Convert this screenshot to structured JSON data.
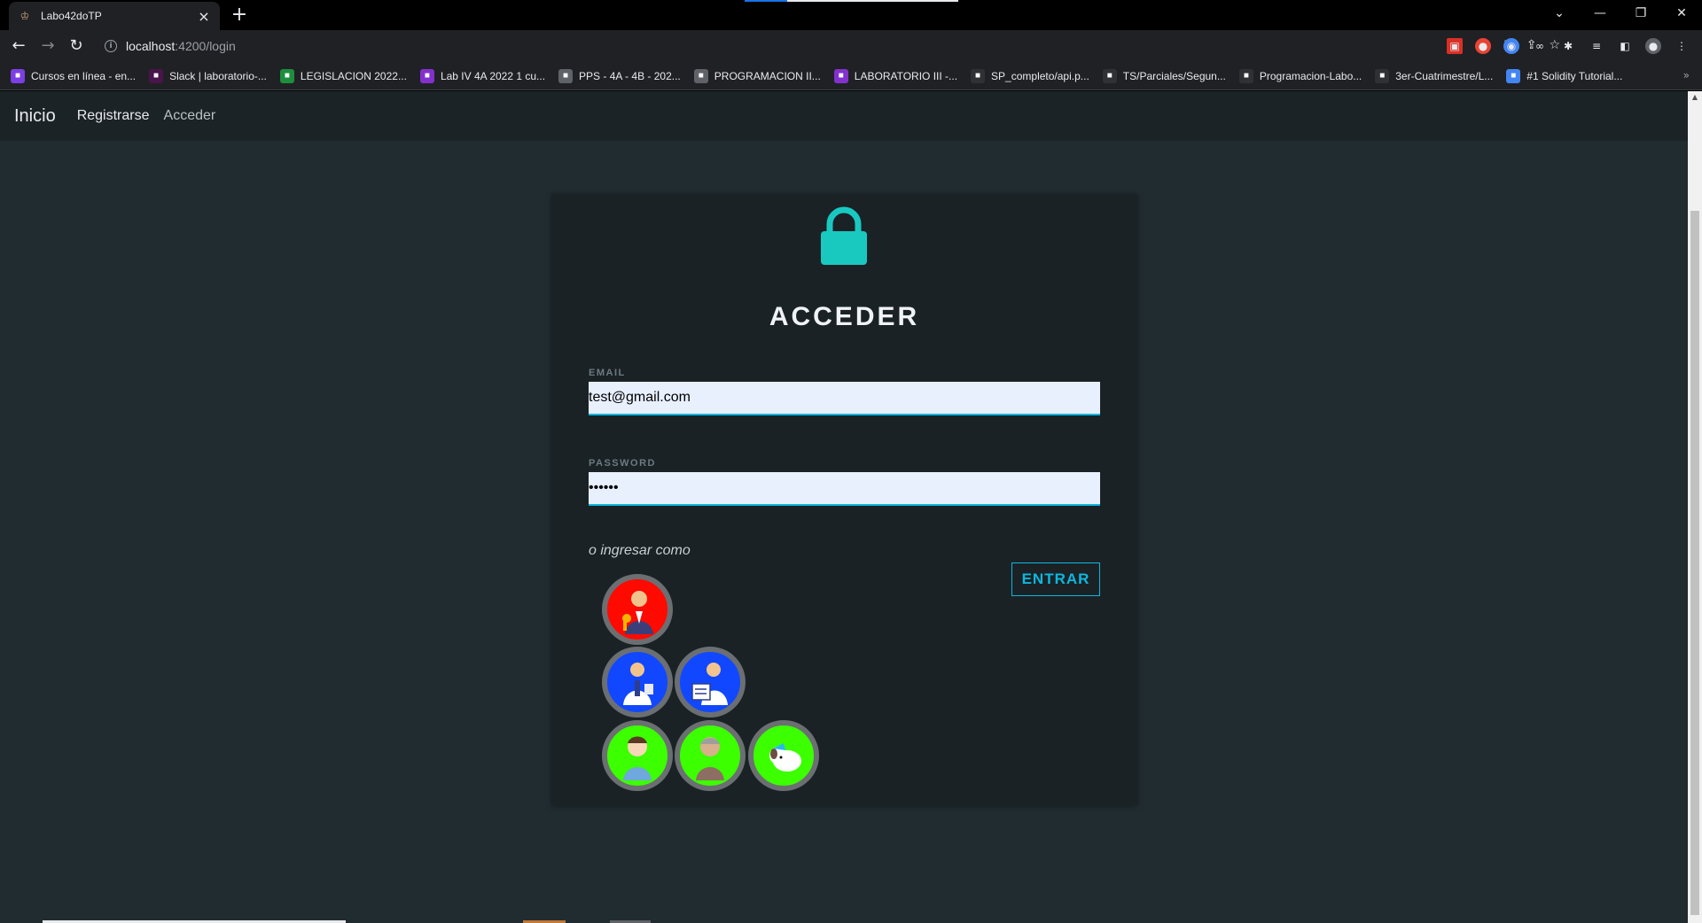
{
  "browser": {
    "tab_title": "Labo42doTP",
    "url_host": "localhost",
    "url_path": ":4200/login",
    "bookmarks": [
      {
        "label": "Cursos en línea - en...",
        "color": "#7b3fe4"
      },
      {
        "label": "Slack | laboratorio-...",
        "color": "#4a154b"
      },
      {
        "label": "LEGISLACION 2022...",
        "color": "#1e8e3e"
      },
      {
        "label": "Lab IV 4A 2022 1 cu...",
        "color": "#8430ce"
      },
      {
        "label": "PPS - 4A - 4B - 202...",
        "color": "#5f6368"
      },
      {
        "label": "PROGRAMACION II...",
        "color": "#5f6368"
      },
      {
        "label": "LABORATORIO III -...",
        "color": "#8430ce"
      },
      {
        "label": "SP_completo/api.p...",
        "color": "#303134"
      },
      {
        "label": "TS/Parciales/Segun...",
        "color": "#303134"
      },
      {
        "label": "Programacion-Labo...",
        "color": "#303134"
      },
      {
        "label": "3er-Cuatrimestre/L...",
        "color": "#303134"
      },
      {
        "label": "#1 Solidity Tutorial...",
        "color": "#4285f4"
      }
    ]
  },
  "navbar": {
    "brand": "Inicio",
    "links": [
      "Registrarse",
      "Acceder"
    ]
  },
  "login": {
    "title": "ACCEDER",
    "email_label": "EMAIL",
    "email_value": "test@gmail.com",
    "password_label": "PASSWORD",
    "password_value": "••••••",
    "quick_login_text": "o ingresar como",
    "submit_label": "ENTRAR"
  },
  "quick_users": [
    {
      "role": "admin",
      "icon": "admin-avatar-icon",
      "color": "#ff0a00"
    },
    {
      "role": "especialista",
      "icon": "doctor-avatar-icon",
      "color": "#1148ff"
    },
    {
      "role": "especialista",
      "icon": "doctor-avatar-icon",
      "color": "#1148ff"
    },
    {
      "role": "paciente",
      "icon": "patient-avatar-icon",
      "color": "#3cff00"
    },
    {
      "role": "paciente",
      "icon": "patient-avatar-icon",
      "color": "#3cff00"
    },
    {
      "role": "paciente",
      "icon": "patient-avatar-icon",
      "color": "#3cff00"
    }
  ],
  "colors": {
    "accent": "#0db8de",
    "background": "#212c31",
    "card": "#1a2226"
  }
}
